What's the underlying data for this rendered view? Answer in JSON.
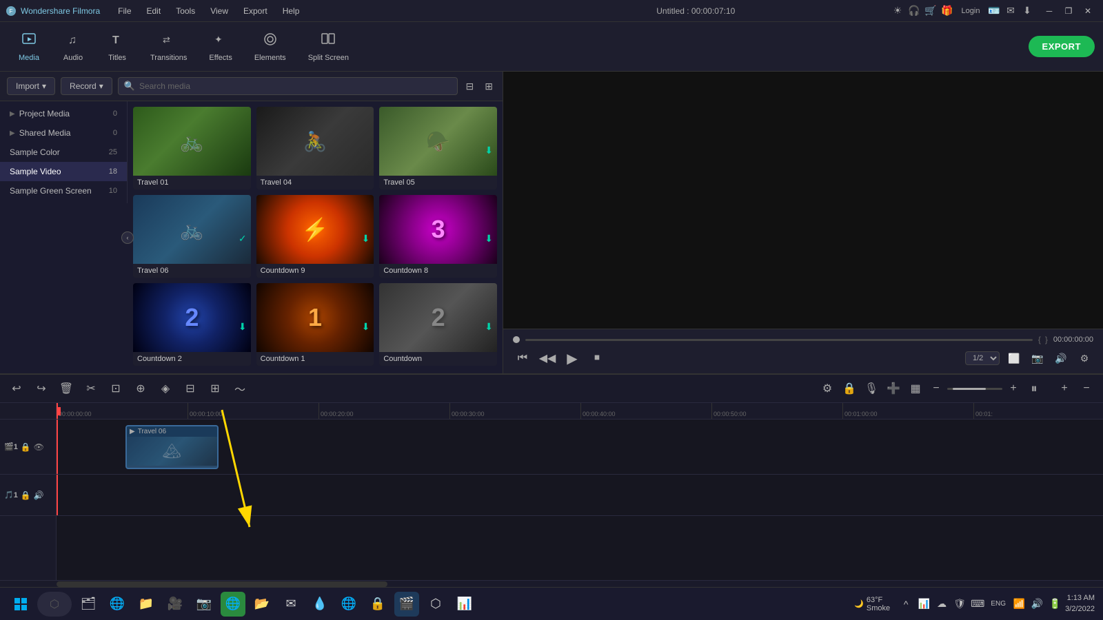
{
  "app": {
    "title": "Wondershare Filmora",
    "window_title": "Untitled : 00:00:07:10"
  },
  "title_bar": {
    "logo": "◆",
    "menus": [
      "File",
      "Edit",
      "Tools",
      "View",
      "Export",
      "Help"
    ],
    "window_controls": [
      "─",
      "❐",
      "✕"
    ]
  },
  "toolbar": {
    "items": [
      {
        "id": "media",
        "label": "Media",
        "icon": "⬛"
      },
      {
        "id": "audio",
        "label": "Audio",
        "icon": "♪"
      },
      {
        "id": "titles",
        "label": "Titles",
        "icon": "T"
      },
      {
        "id": "transitions",
        "label": "Transitions",
        "icon": "⇄"
      },
      {
        "id": "effects",
        "label": "Effects",
        "icon": "✨"
      },
      {
        "id": "elements",
        "label": "Elements",
        "icon": "◎"
      },
      {
        "id": "split_screen",
        "label": "Split Screen",
        "icon": "▦"
      }
    ],
    "export_label": "EXPORT"
  },
  "media_controls": {
    "import_label": "Import",
    "import_arrow": "▾",
    "record_label": "Record",
    "record_arrow": "▾",
    "search_placeholder": "Search media",
    "filter_icon": "filter",
    "grid_icon": "grid"
  },
  "sidebar": {
    "items": [
      {
        "id": "project_media",
        "label": "Project Media",
        "count": "0",
        "has_arrow": true
      },
      {
        "id": "shared_media",
        "label": "Shared Media",
        "count": "0",
        "has_arrow": true
      },
      {
        "id": "sample_color",
        "label": "Sample Color",
        "count": "25",
        "has_arrow": false
      },
      {
        "id": "sample_video",
        "label": "Sample Video",
        "count": "18",
        "has_arrow": false,
        "active": true
      },
      {
        "id": "sample_green",
        "label": "Sample Green Screen",
        "count": "10",
        "has_arrow": false
      }
    ]
  },
  "media_grid": {
    "items": [
      {
        "id": "travel01",
        "label": "Travel 01",
        "thumb_class": "thumb-travel01",
        "has_download": false,
        "has_check": false
      },
      {
        "id": "travel04",
        "label": "Travel 04",
        "thumb_class": "thumb-travel04",
        "has_download": false,
        "has_check": false
      },
      {
        "id": "travel05",
        "label": "Travel 05",
        "thumb_class": "thumb-travel05",
        "has_download": true,
        "has_check": false
      },
      {
        "id": "travel06",
        "label": "Travel 06",
        "thumb_class": "thumb-travel06",
        "has_download": false,
        "has_check": true
      },
      {
        "id": "countdown9",
        "label": "Countdown 9",
        "thumb_class": "thumb-countdown9",
        "has_download": true,
        "has_check": false,
        "number": ""
      },
      {
        "id": "countdown8",
        "label": "Countdown 8",
        "thumb_class": "thumb-countdown8",
        "has_download": true,
        "has_check": false,
        "number": "3"
      },
      {
        "id": "countdown2a",
        "label": "Countdown 2",
        "thumb_class": "thumb-countdown2a",
        "has_download": true,
        "has_check": false,
        "number": "2"
      },
      {
        "id": "countdown1",
        "label": "Countdown 1",
        "thumb_class": "thumb-countdown1",
        "has_download": true,
        "has_check": false,
        "number": "1"
      },
      {
        "id": "countdown2b",
        "label": "Countdown",
        "thumb_class": "thumb-countdown2b",
        "has_download": true,
        "has_check": false,
        "number": "2"
      }
    ]
  },
  "player": {
    "progress": 0,
    "time_current": "00:00:00:00",
    "time_bracket_left": "{",
    "time_bracket_right": "}",
    "speed": "1/2",
    "buttons": [
      "⏮",
      "⏯",
      "▶",
      "⏹"
    ]
  },
  "timeline": {
    "ruler_marks": [
      "00:00:00:00",
      "00:00:10:00",
      "00:00:20:00",
      "00:00:30:00",
      "00:00:40:00",
      "00:00:50:00",
      "00:01:00:00",
      "00:01:"
    ],
    "clip": {
      "label": "Travel 06",
      "play_icon": "▶"
    },
    "track1_icons": [
      "#1",
      "🔒",
      "👁"
    ],
    "track2_icons": [
      "#1",
      "🔒",
      "🔊"
    ]
  },
  "taskbar": {
    "start_icon": "⊞",
    "apps": [
      "⬡",
      "📁",
      "🎥",
      "📷",
      "🌐",
      "📂",
      "✉",
      "💧",
      "🌐",
      "🔒",
      "🎬",
      "⬡",
      "📊"
    ],
    "time": "1:13 AM",
    "date": "3/2/2022",
    "weather": "☁",
    "temperature": "63°F",
    "weather_label": "Smoke"
  },
  "colors": {
    "accent": "#7ec8e3",
    "active_bg": "#2a2a4e",
    "export_green": "#1db954",
    "playhead_red": "#ff4444",
    "download_teal": "#00d4aa"
  }
}
